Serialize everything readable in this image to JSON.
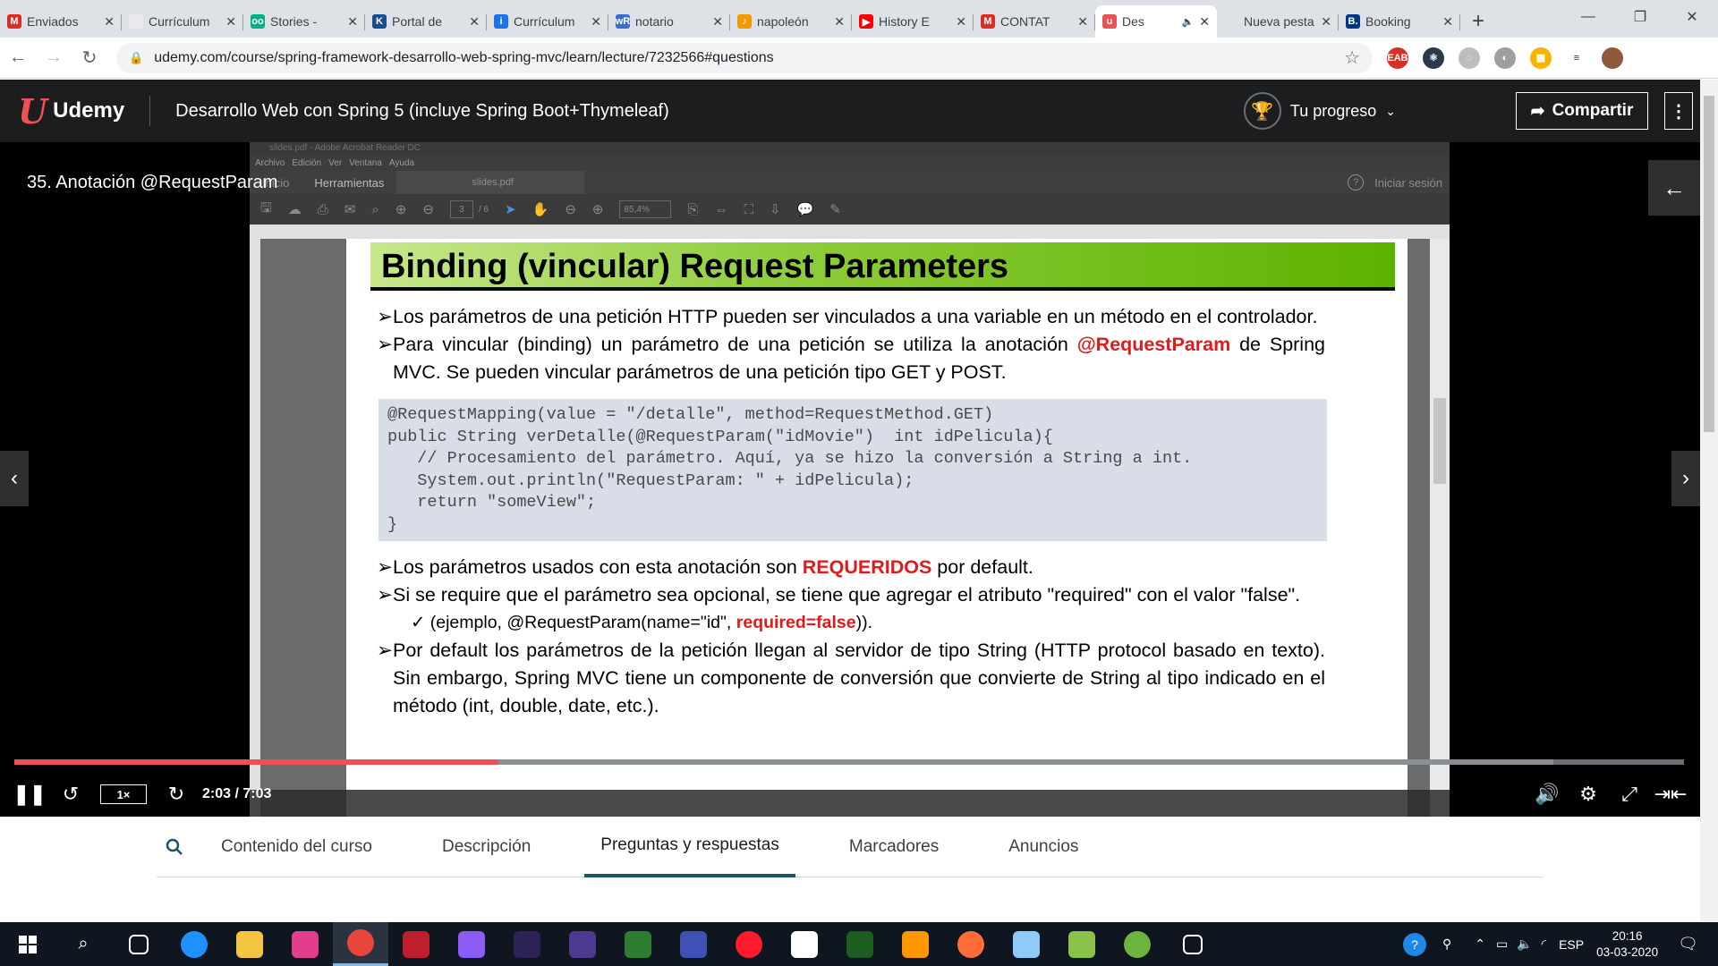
{
  "browser": {
    "tabs": [
      {
        "label": "Enviados",
        "icon": "gmail-icon",
        "color": "#d93025",
        "glyph": "M",
        "active": false
      },
      {
        "label": "Currículum",
        "icon": "web-icon",
        "color": "#e8eaed",
        "glyph": "",
        "active": false
      },
      {
        "label": "Stories -",
        "icon": "owl-icon",
        "color": "#00af87",
        "glyph": "oo",
        "active": false
      },
      {
        "label": "Portal de",
        "icon": "k-icon",
        "color": "#1a4e8a",
        "glyph": "K",
        "active": false
      },
      {
        "label": "Currículum",
        "icon": "info-icon",
        "color": "#1a73e8",
        "glyph": "i",
        "active": false
      },
      {
        "label": "notario",
        "icon": "wr-icon",
        "color": "#3b6ecb",
        "glyph": "wR",
        "active": false
      },
      {
        "label": "napoleón",
        "icon": "flame-icon",
        "color": "#f29900",
        "glyph": "♪",
        "active": false
      },
      {
        "label": "History E",
        "icon": "youtube-icon",
        "color": "#ff0000",
        "glyph": "▶",
        "active": false
      },
      {
        "label": "CONTAT",
        "icon": "gmail-icon",
        "color": "#d93025",
        "glyph": "M",
        "active": false
      },
      {
        "label": "Des",
        "icon": "udemy-icon",
        "color": "#ec5252",
        "glyph": "u",
        "active": true,
        "audio": "🔈"
      },
      {
        "label": "Nueva pesta",
        "icon": "blank-icon",
        "color": "#dee1e6",
        "glyph": "",
        "active": false
      },
      {
        "label": "Booking",
        "icon": "booking-icon",
        "color": "#003580",
        "glyph": "B.",
        "active": false
      }
    ],
    "new_tab": "+",
    "window_controls": [
      "—",
      "❐",
      "✕"
    ],
    "url": "udemy.com/course/spring-framework-desarrollo-web-spring-mvc/learn/lecture/7232566#questions",
    "extensions": [
      {
        "name": "adblock-icon",
        "color": "#d93025",
        "glyph": "EAB"
      },
      {
        "name": "react-icon",
        "color": "#2b3a4a",
        "glyph": "⚛"
      },
      {
        "name": "grey-circle-icon",
        "color": "#bdbdbd",
        "glyph": "◌"
      },
      {
        "name": "grey-swirl-icon",
        "color": "#9e9e9e",
        "glyph": "◐"
      },
      {
        "name": "colorful-grid-icon",
        "color": "#f4b400",
        "glyph": "▦"
      },
      {
        "name": "playlist-icon",
        "color": "#ffffff",
        "glyph": "≡"
      },
      {
        "name": "avatar-icon",
        "color": "#8d5a3b",
        "glyph": ""
      }
    ]
  },
  "udemy": {
    "logo_glyph": "U",
    "logo_text": "Udemy",
    "course_title": "Desarrollo Web con Spring 5 (incluye Spring Boot+Thymeleaf)",
    "progress_label": "Tu progreso",
    "share_label": "Compartir",
    "lecture_title": "35. Anotación @RequestParam"
  },
  "acrobat": {
    "window_title": "slides.pdf - Adobe Acrobat Reader DC",
    "menu": [
      "Archivo",
      "Edición",
      "Ver",
      "Ventana",
      "Ayuda"
    ],
    "tabs": [
      "Inicio",
      "Herramientas"
    ],
    "doc_tab": "slides.pdf",
    "help": "?",
    "signin": "Iniciar sesión",
    "page_current": "3",
    "page_total": "/ 6",
    "zoom": "85,4%"
  },
  "slide": {
    "title": "Binding (vincular) Request Parameters",
    "bullet1": "Los parámetros de una petición HTTP pueden ser vinculados a una variable en un método en el controlador.",
    "bullet2_pre": "Para vincular (binding) un parámetro de una petición se utiliza la anotación ",
    "bullet2_red": "@RequestParam",
    "bullet2_post": " de Spring MVC. Se pueden vincular parámetros de una petición tipo GET y POST.",
    "code": "@RequestMapping(value = \"/detalle\", method=RequestMethod.GET)\npublic String verDetalle(@RequestParam(\"idMovie\")  int idPelicula){\n   // Procesamiento del parámetro. Aquí, ya se hizo la conversión a String a int.\n   System.out.println(\"RequestParam: \" + idPelicula);\n   return \"someView\";\n}",
    "bullet3_pre": "Los parámetros usados con esta anotación son ",
    "bullet3_red": "REQUERIDOS",
    "bullet3_post": " por default.",
    "bullet4": "Si se require que el parámetro sea opcional, se tiene que agregar el atributo \"required\" con el valor \"false\".",
    "sub_pre": "(ejemplo, @RequestParam(name=\"id\", ",
    "sub_red": "required=false",
    "sub_post": ")).",
    "bullet5": "Por default los parámetros de la petición llegan al servidor de tipo String (HTTP protocol basado en texto). Sin embargo, Spring MVC tiene un componente de conversión que convierte de String al tipo indicado en el método (int, double, date, etc.).",
    "bullet_marker": "➢",
    "sub_marker": "✓"
  },
  "player": {
    "speed": "1×",
    "time": "2:03 / 7:03",
    "progress_fraction": 0.29
  },
  "page_tabs": [
    "Contenido del curso",
    "Descripción",
    "Preguntas y respuestas",
    "Marcadores",
    "Anuncios"
  ],
  "page_tab_active": 2,
  "taskbar": {
    "apps": [
      {
        "name": "task-view-icon",
        "color": "#ffffff"
      },
      {
        "name": "edge-icon",
        "color": "#1e90ff"
      },
      {
        "name": "file-explorer-icon",
        "color": "#f4c542"
      },
      {
        "name": "webstorm-icon",
        "color": "#e23d8f"
      },
      {
        "name": "chrome-icon",
        "color": "#e8453c"
      },
      {
        "name": "filezilla-icon",
        "color": "#bf1e2d"
      },
      {
        "name": "balloon-icon",
        "color": "#8b5cf6"
      },
      {
        "name": "eclipse-icon",
        "color": "#2c2255"
      },
      {
        "name": "eclipse2-icon",
        "color": "#4b3a8f"
      },
      {
        "name": "ws-icon",
        "color": "#2e7d32"
      },
      {
        "name": "network-icon",
        "color": "#3f51b5"
      },
      {
        "name": "opera-icon",
        "color": "#ff1b2d"
      },
      {
        "name": "notepad-icon",
        "color": "#ffffff"
      },
      {
        "name": "terminal-icon",
        "color": "#1b5e20"
      },
      {
        "name": "sublime-icon",
        "color": "#ff9800"
      },
      {
        "name": "postman-icon",
        "color": "#ff6c37"
      },
      {
        "name": "notes-icon",
        "color": "#90caf9"
      },
      {
        "name": "android-icon",
        "color": "#8bc34a"
      },
      {
        "name": "spring-icon",
        "color": "#6db33f"
      },
      {
        "name": "settings-icon",
        "color": "#ffffff"
      }
    ],
    "language": "ESP",
    "time": "20:16",
    "date": "03-03-2020"
  }
}
